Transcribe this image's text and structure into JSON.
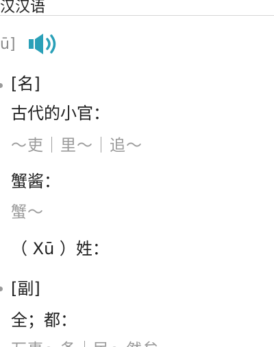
{
  "header": {
    "title": "汉汉语"
  },
  "pronunciation": {
    "text": "ū]",
    "speaker_icon": "speaker-icon"
  },
  "entries": [
    {
      "pos": "[名]",
      "senses": [
        {
          "definition": "古代的小官：",
          "example": "～吏｜里～｜追～"
        },
        {
          "definition": "蟹酱：",
          "example": "蟹～"
        },
        {
          "definition": "（ Xū ）姓：",
          "example": ""
        }
      ]
    },
    {
      "pos": "[副]",
      "senses": [
        {
          "definition": "全；都：",
          "example": "万事～备｜民～然矣"
        }
      ]
    }
  ],
  "colors": {
    "speaker": "#2aa0b8",
    "example_text": "#9a9a9a",
    "pron_text": "#8a8a8a"
  }
}
